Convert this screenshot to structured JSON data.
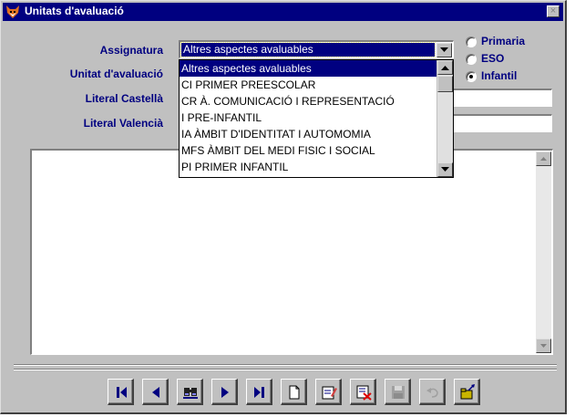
{
  "window": {
    "title": "Unitats d'avaluació",
    "close_glyph": "×"
  },
  "form": {
    "assignatura_label": "Assignatura",
    "unitat_label": "Unitat d'avaluació",
    "literal_castella_label": "Literal Castellà",
    "literal_valencia_label": "Literal Valencià",
    "assignatura_value": "Altres aspectes avaluables",
    "literal_castella_value": "",
    "literal_valencia_value": "",
    "description_value": ""
  },
  "dropdown": {
    "items": [
      "Altres aspectes avaluables",
      "CI  PRIMER PREESCOLAR",
      "CR  À. COMUNICACIÓ I REPRESENTACIÓ",
      "I   PRE-INFANTIL",
      "IA  ÀMBIT D'IDENTITAT I AUTOMOMIA",
      "MFS ÀMBIT DEL MEDI FISIC I SOCIAL",
      "PI  PRIMER INFANTIL"
    ],
    "selected_index": 0
  },
  "level_options": {
    "items": [
      "Primaria",
      "ESO",
      "Infantil"
    ],
    "selected": "Infantil"
  },
  "toolbar": {
    "buttons": [
      {
        "name": "first-record-button",
        "icon": "first-record-icon",
        "enabled": true
      },
      {
        "name": "previous-record-button",
        "icon": "previous-record-icon",
        "enabled": true
      },
      {
        "name": "find-button",
        "icon": "binoculars-icon",
        "enabled": true
      },
      {
        "name": "next-record-button",
        "icon": "next-record-icon",
        "enabled": true
      },
      {
        "name": "last-record-button",
        "icon": "last-record-icon",
        "enabled": true
      },
      {
        "name": "new-record-button",
        "icon": "new-document-icon",
        "enabled": true
      },
      {
        "name": "edit-record-button",
        "icon": "edit-icon",
        "enabled": true
      },
      {
        "name": "delete-record-button",
        "icon": "delete-icon",
        "enabled": true
      },
      {
        "name": "save-button",
        "icon": "floppy-disk-icon",
        "enabled": false
      },
      {
        "name": "undo-button",
        "icon": "undo-icon",
        "enabled": false
      },
      {
        "name": "exit-button",
        "icon": "exit-folder-icon",
        "enabled": true
      }
    ]
  },
  "colors": {
    "title_bar": "#000080",
    "label_text": "#000080",
    "face": "#c0c0c0"
  }
}
